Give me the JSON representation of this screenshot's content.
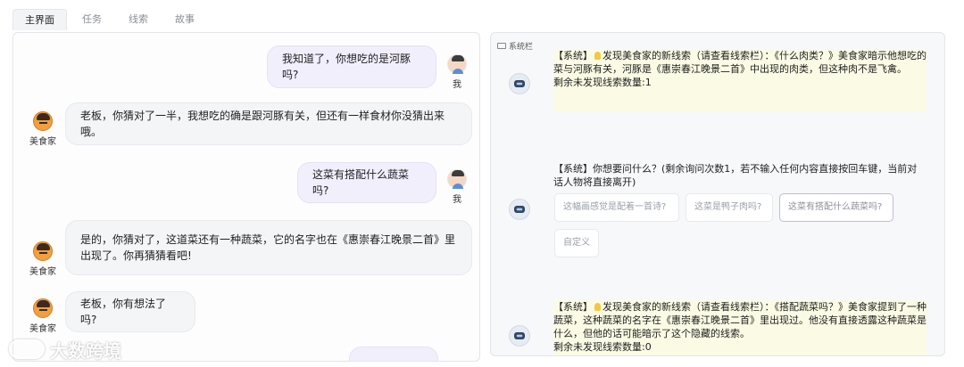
{
  "tabs": [
    {
      "label": "主界面",
      "active": true
    },
    {
      "label": "任务",
      "active": false
    },
    {
      "label": "线索",
      "active": false
    },
    {
      "label": "故事",
      "active": false
    }
  ],
  "chat": {
    "messages": [
      {
        "role": "user",
        "speaker": "我",
        "text": "我知道了，你想吃的是河豚吗?"
      },
      {
        "role": "npc",
        "speaker": "美食家",
        "text": "老板，你猜对了一半，我想吃的确是跟河豚有关，但还有一样食材你没猜出来哦。"
      },
      {
        "role": "user",
        "speaker": "我",
        "text": "这菜有搭配什么蔬菜吗?"
      },
      {
        "role": "npc",
        "speaker": "美食家",
        "text": "是的，你猜对了，这道菜还有一种蔬菜，它的名字也在《惠崇春江晚景二首》里出现了。你再猜猜看吧!"
      },
      {
        "role": "npc",
        "speaker": "美食家",
        "text": "老板，你有想法了吗?"
      }
    ]
  },
  "system": {
    "header": "系统栏",
    "messages": [
      {
        "prefix": "【系统】",
        "text": "发现美食家的新线索（请查看线索栏）：《什么肉类？》美食家暗示他想吃的菜与河豚有关，河豚是《惠崇春江晚景二首》中出现的肉类，但这种肉不是飞禽。",
        "footer": "剩余未发现线索数量:1"
      },
      {
        "prefix": "【系统】",
        "text": "你想要问什么？(剩余询问次数1，若不输入任何内容直接按回车键，当前对话人物将直接离开)"
      },
      {
        "prefix": "【系统】",
        "text": "发现美食家的新线索（请查看线索栏）：《搭配蔬菜吗？》美食家提到了一种蔬菜，这种蔬菜的名字在《惠崇春江晚景二首》里出现过。他没有直接透露这种蔬菜是什么，但他的话可能暗示了这个隐藏的线索。",
        "footer": "剩余未发现线索数量:0"
      }
    ],
    "options": [
      {
        "label": "这幅画感觉是配着一首诗?",
        "selected": false
      },
      {
        "label": "这菜是鸭子肉吗?",
        "selected": false
      },
      {
        "label": "这菜有搭配什么蔬菜吗?",
        "selected": true
      },
      {
        "label": "自定义",
        "selected": false
      }
    ]
  },
  "watermark": "大数跨境",
  "icons": [
    "user-avatar-icon",
    "chef-avatar-icon",
    "robot-icon",
    "panel-icon",
    "lightbulb-icon"
  ]
}
